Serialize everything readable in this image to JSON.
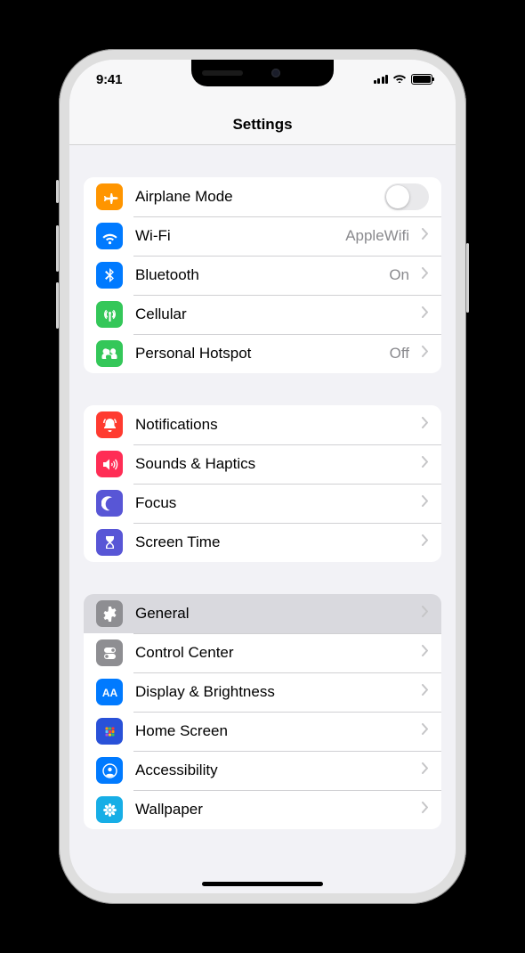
{
  "status": {
    "time": "9:41"
  },
  "header": {
    "title": "Settings"
  },
  "groups": [
    {
      "id": "connectivity",
      "items": [
        {
          "id": "airplane",
          "icon": "airplane-icon",
          "color": "c-orange",
          "label": "Airplane Mode",
          "type": "switch",
          "switch_on": false
        },
        {
          "id": "wifi",
          "icon": "wifi-icon",
          "color": "c-blue",
          "label": "Wi-Fi",
          "type": "nav",
          "value": "AppleWifi"
        },
        {
          "id": "bluetooth",
          "icon": "bluetooth-icon",
          "color": "c-blue",
          "label": "Bluetooth",
          "type": "nav",
          "value": "On"
        },
        {
          "id": "cellular",
          "icon": "antenna-icon",
          "color": "c-green",
          "label": "Cellular",
          "type": "nav"
        },
        {
          "id": "hotspot",
          "icon": "hotspot-icon",
          "color": "c-green",
          "label": "Personal Hotspot",
          "type": "nav",
          "value": "Off"
        }
      ]
    },
    {
      "id": "alerts",
      "items": [
        {
          "id": "notifications",
          "icon": "bell-icon",
          "color": "c-red",
          "label": "Notifications",
          "type": "nav"
        },
        {
          "id": "sounds",
          "icon": "speaker-icon",
          "color": "c-pink",
          "label": "Sounds & Haptics",
          "type": "nav"
        },
        {
          "id": "focus",
          "icon": "moon-icon",
          "color": "c-indigo",
          "label": "Focus",
          "type": "nav"
        },
        {
          "id": "screentime",
          "icon": "hourglass-icon",
          "color": "c-indigo",
          "label": "Screen Time",
          "type": "nav"
        }
      ]
    },
    {
      "id": "system",
      "items": [
        {
          "id": "general",
          "icon": "gear-icon",
          "color": "c-gray",
          "label": "General",
          "type": "nav",
          "selected": true
        },
        {
          "id": "controlcenter",
          "icon": "switches-icon",
          "color": "c-gray",
          "label": "Control Center",
          "type": "nav"
        },
        {
          "id": "display",
          "icon": "textsize-icon",
          "color": "c-blue",
          "label": "Display & Brightness",
          "type": "nav"
        },
        {
          "id": "homescreen",
          "icon": "grid-icon",
          "color": "c-darkblue",
          "label": "Home Screen",
          "type": "nav"
        },
        {
          "id": "accessibility",
          "icon": "person-icon",
          "color": "c-blue",
          "label": "Accessibility",
          "type": "nav"
        },
        {
          "id": "wallpaper",
          "icon": "flower-icon",
          "color": "c-cyan",
          "label": "Wallpaper",
          "type": "nav"
        }
      ]
    }
  ]
}
